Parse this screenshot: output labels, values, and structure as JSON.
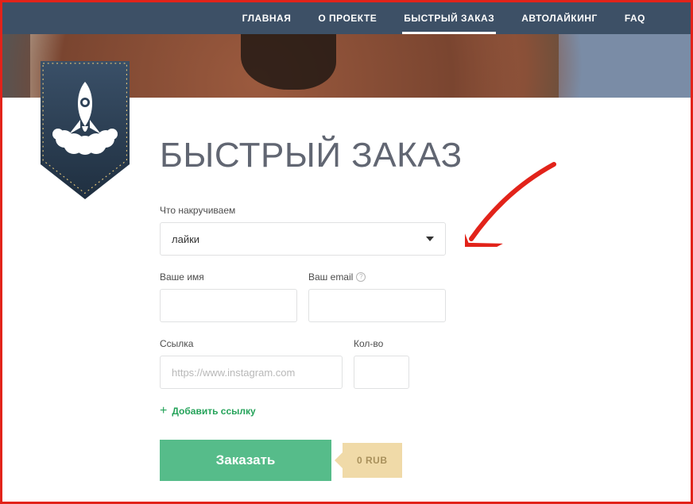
{
  "nav": {
    "items": [
      "ГЛАВНАЯ",
      "О ПРОЕКТЕ",
      "БЫСТРЫЙ ЗАКАЗ",
      "АВТОЛАЙКИНГ",
      "FAQ"
    ],
    "active_index": 2
  },
  "page": {
    "title": "БЫСТРЫЙ ЗАКАЗ"
  },
  "form": {
    "what_label": "Что накручиваем",
    "what_value": "лайки",
    "name_label": "Ваше имя",
    "email_label": "Ваш email",
    "link_label": "Ссылка",
    "link_placeholder": "https://www.instagram.com",
    "qty_label": "Кол-во",
    "add_link": "Добавить ссылку",
    "submit": "Заказать",
    "price": "0 RUB"
  }
}
